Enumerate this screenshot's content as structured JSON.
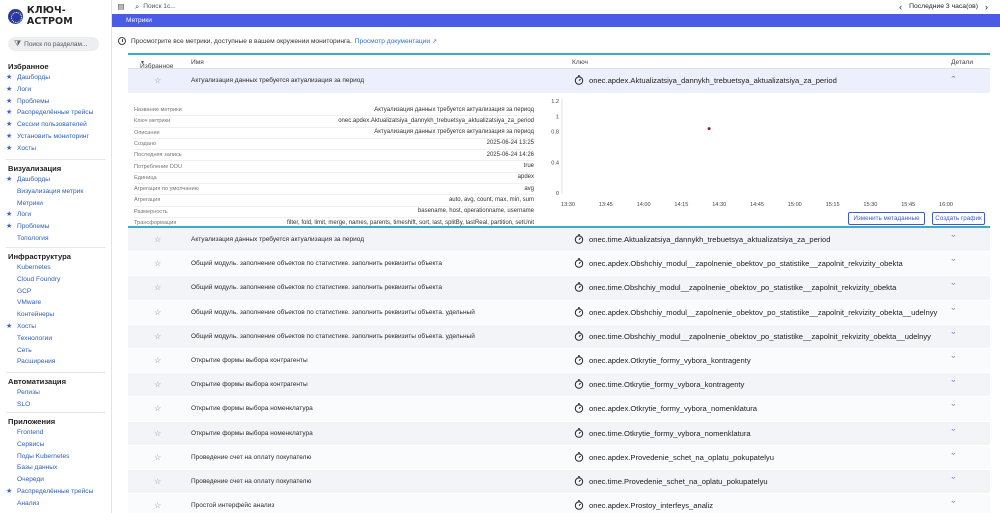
{
  "app": {
    "logo_text": "КЛЮЧ-АСТРОМ"
  },
  "topbar": {
    "search_placeholder": "Поиск 1с...",
    "time_range": "Последние 3 часа(ов)",
    "prev_icon": "chevron-left-icon",
    "next_icon": "chevron-right-icon"
  },
  "sidebar": {
    "search_placeholder": "Поиск по разделам...",
    "sections": [
      {
        "title": "Избранное",
        "items": [
          {
            "label": "Дашборды",
            "star": true
          },
          {
            "label": "Логи",
            "star": true
          },
          {
            "label": "Проблемы",
            "star": true
          },
          {
            "label": "Распределённые трейсы",
            "star": true
          },
          {
            "label": "Сессии пользователей",
            "star": true
          },
          {
            "label": "Установить мониторинг",
            "star": true
          },
          {
            "label": "Хосты",
            "star": true
          }
        ]
      },
      {
        "title": "Визуализация",
        "items": [
          {
            "label": "Дашборды",
            "star": true
          },
          {
            "label": "Визуализация метрик",
            "star": false
          },
          {
            "label": "Метрики",
            "star": false
          },
          {
            "label": "Логи",
            "star": true
          },
          {
            "label": "Проблемы",
            "star": true
          },
          {
            "label": "Топология",
            "star": false
          }
        ]
      },
      {
        "title": "Инфраструктура",
        "items": [
          {
            "label": "Kubernetes",
            "star": false
          },
          {
            "label": "Cloud Foundry",
            "star": false
          },
          {
            "label": "GCP",
            "star": false
          },
          {
            "label": "VMware",
            "star": false
          },
          {
            "label": "Контейнеры",
            "star": false
          },
          {
            "label": "Хосты",
            "star": true
          },
          {
            "label": "Технологии",
            "star": false
          },
          {
            "label": "Сеть",
            "star": false
          },
          {
            "label": "Расширения",
            "star": false
          }
        ]
      },
      {
        "title": "Автоматизация",
        "items": [
          {
            "label": "Релизы",
            "star": false
          },
          {
            "label": "SLO",
            "star": false
          }
        ]
      },
      {
        "title": "Приложения",
        "items": [
          {
            "label": "Frontend",
            "star": false
          },
          {
            "label": "Сервисы",
            "star": false
          },
          {
            "label": "Поды Kubernetes",
            "star": false
          },
          {
            "label": "Базы данных",
            "star": false
          },
          {
            "label": "Очереди",
            "star": false
          },
          {
            "label": "Распределённые трейсы",
            "star": true
          },
          {
            "label": "Анализ",
            "star": false
          }
        ]
      }
    ]
  },
  "page": {
    "title": "Метрики",
    "info_text": "Просмотрите все метрики, доступные в вашем окружении мониторинга.",
    "doc_link": "Просмотр документации"
  },
  "table": {
    "headers": {
      "favorite": "Избранное",
      "name": "Имя",
      "key": "Ключ",
      "details": "Детали"
    },
    "expanded": {
      "name": "Актуализация данных требуется актуализация за период",
      "key": "onec.apdex.Aktualizatsiya_dannykh_trebuetsya_aktualizatsiya_za_period",
      "properties": [
        {
          "label": "Название метрики",
          "value": "Актуализация данных требуется актуализация за период"
        },
        {
          "label": "Ключ метрики",
          "value": "onec.apdex.Aktualizatsiya_dannykh_trebuetsya_aktualizatsiya_za_period"
        },
        {
          "label": "Описание",
          "value": "Актуализация данных требуется актуализация за период"
        },
        {
          "label": "Создано",
          "value": "2025-06-24 13:25"
        },
        {
          "label": "Последняя запись",
          "value": "2025-06-24 14:26"
        },
        {
          "label": "Потребление DDU",
          "value": "true"
        },
        {
          "label": "Единица",
          "value": "apdex"
        },
        {
          "label": "Агрегация по умолчанию",
          "value": "avg"
        },
        {
          "label": "Агрегация",
          "value": "auto, avg, count, max, min, sum"
        },
        {
          "label": "Размерность",
          "value": "basename, host, operationname, username"
        },
        {
          "label": "Трансформация",
          "value": "filter, fold, limit, merge, names, parents, timeshift, sort, last, splitBy, lastReal, partition, setUnit"
        }
      ],
      "buttons": {
        "edit_metadata": "Изменить метаданные",
        "create_chart": "Создать график"
      }
    },
    "rows": [
      {
        "name": "Актуализация данных требуется актуализация за период",
        "key": "onec.time.Aktualizatsiya_dannykh_trebuetsya_aktualizatsiya_za_period"
      },
      {
        "name": "Общий модуль. заполнение объектов по статистике. заполнить реквизиты объекта",
        "key": "onec.apdex.Obshchiy_modul__zapolnenie_obektov_po_statistike__zapolnit_rekvizity_obekta"
      },
      {
        "name": "Общий модуль. заполнение объектов по статистике. заполнить реквизиты объекта",
        "key": "onec.time.Obshchiy_modul__zapolnenie_obektov_po_statistike__zapolnit_rekvizity_obekta"
      },
      {
        "name": "Общий модуль. заполнение объектов по статистике. заполнить реквизиты объекта. удельный",
        "key": "onec.apdex.Obshchiy_modul__zapolnenie_obektov_po_statistike__zapolnit_rekvizity_obekta__udelnyy"
      },
      {
        "name": "Общий модуль. заполнение объектов по статистике. заполнить реквизиты объекта. удельный",
        "key": "onec.time.Obshchiy_modul__zapolnenie_obektov_po_statistike__zapolnit_rekvizity_obekta__udelnyy"
      },
      {
        "name": "Открытие формы выбора контрагенты",
        "key": "onec.apdex.Otkrytie_formy_vybora_kontragenty"
      },
      {
        "name": "Открытие формы выбора контрагенты",
        "key": "onec.time.Otkrytie_formy_vybora_kontragenty"
      },
      {
        "name": "Открытие формы выбора номенклатура",
        "key": "onec.apdex.Otkrytie_formy_vybora_nomenklatura"
      },
      {
        "name": "Открытие формы выбора номенклатура",
        "key": "onec.time.Otkrytie_formy_vybora_nomenklatura"
      },
      {
        "name": "Проведение счет на оплату покупателю",
        "key": "onec.apdex.Provedenie_schet_na_oplatu_pokupatelyu"
      },
      {
        "name": "Проведение счет на оплату покупателю",
        "key": "onec.time.Provedenie_schet_na_oplatu_pokupatelyu"
      },
      {
        "name": "Простой интерфейс анализ",
        "key": "onec.apdex.Prostoy_interfeys_analiz"
      }
    ]
  },
  "chart_data": {
    "type": "scatter",
    "x_ticks": [
      "13:30",
      "13:45",
      "14:00",
      "14:15",
      "14:30",
      "14:45",
      "15:00",
      "15:15",
      "15:30",
      "15:45",
      "16:00"
    ],
    "y_ticks": [
      "1.2",
      "1",
      "0.8",
      "0.4",
      "0"
    ],
    "y_tick_values": [
      1.2,
      1.0,
      0.8,
      0.4,
      0
    ],
    "ylim": [
      0,
      1.2
    ],
    "points": [
      {
        "x": "14:26",
        "y": 0.84
      }
    ],
    "point_color": "#8b1a5a",
    "grid": false
  }
}
